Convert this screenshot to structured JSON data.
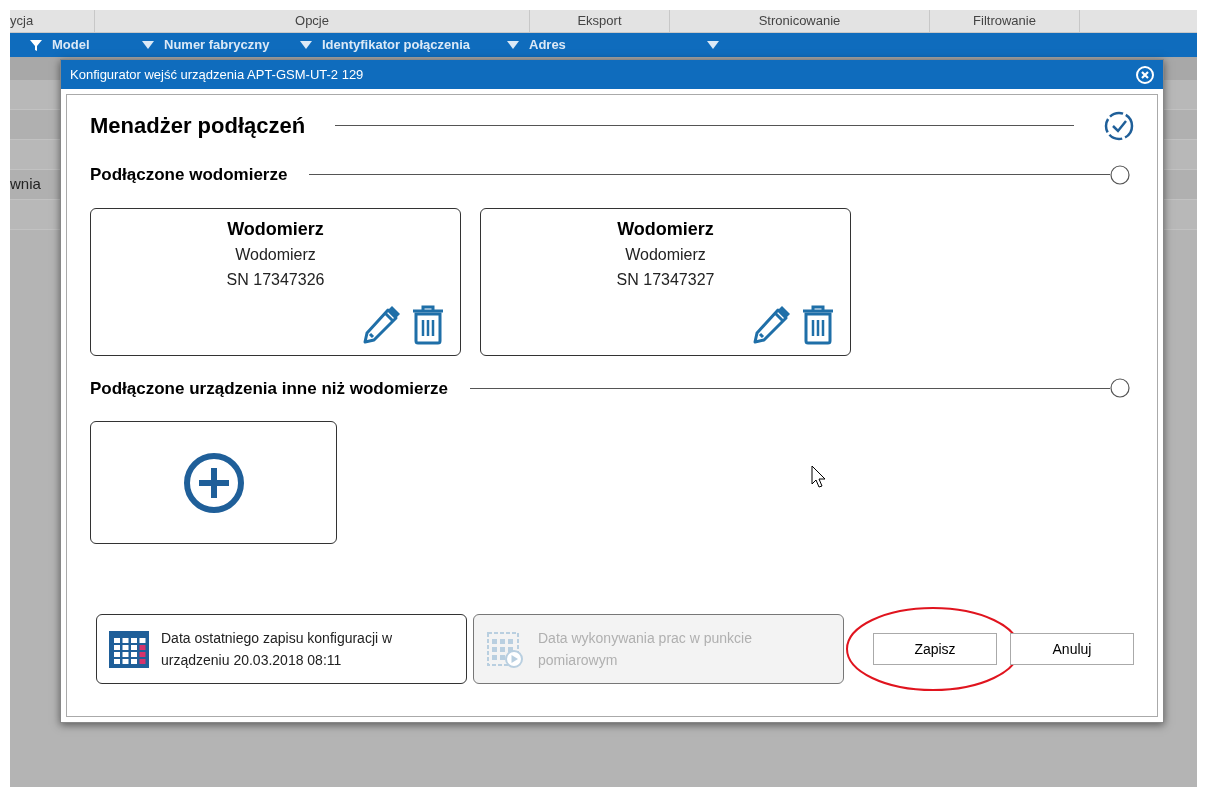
{
  "background": {
    "group_headers": [
      "ycja",
      "Opcje",
      "Eksport",
      "Stronicowanie",
      "Filtrowanie"
    ],
    "columns": [
      "Model",
      "Numer fabryczny",
      "Identyfikator połączenia",
      "Adres"
    ],
    "rows": [
      {
        "cell": ""
      },
      {
        "cell": ""
      },
      {
        "cell": ""
      },
      {
        "cell": "wnia"
      },
      {
        "cell": ""
      }
    ]
  },
  "dialog": {
    "title": "Konfigurator wejść urządzenia APT-GSM-UT-2 129",
    "heading": "Menadżer podłączeń",
    "sections": [
      {
        "title": "Podłączone wodomierze",
        "cards": [
          {
            "kind": "device",
            "title": "Wodomierz",
            "type": "Wodomierz",
            "serial": "SN 17347326"
          },
          {
            "kind": "device",
            "title": "Wodomierz",
            "type": "Wodomierz",
            "serial": "SN 17347327"
          }
        ]
      },
      {
        "title": "Podłączone urządzenia inne niż wodomierze",
        "cards": [
          {
            "kind": "add"
          }
        ]
      }
    ],
    "info_buttons": [
      {
        "kind": "calendar",
        "text": "Data ostatniego zapisu konfiguracji w urządzeniu 20.03.2018 08:11",
        "disabled": false
      },
      {
        "kind": "schedule",
        "text": "Data wykonywania prac w punkcie pomiarowym",
        "disabled": true
      }
    ],
    "buttons": [
      {
        "label": "Zapisz",
        "highlighted": true
      },
      {
        "label": "Anuluj",
        "highlighted": false
      }
    ]
  }
}
